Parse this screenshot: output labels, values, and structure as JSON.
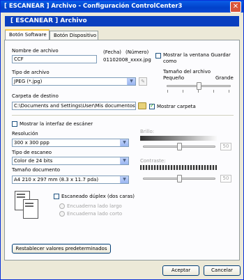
{
  "window": {
    "title": "[ ESCANEAR ]   Archivo - Configuración ControlCenter3",
    "close_symbol": "✕"
  },
  "header": {
    "title": "[ ESCANEAR ]   Archivo"
  },
  "tabs": [
    {
      "label": "Botón Software",
      "active": true
    },
    {
      "label": "Botón Dispositivo",
      "active": false
    }
  ],
  "file": {
    "name_label": "Nombre de archivo",
    "name_value": "CCF",
    "date_label": "(Fecha)",
    "number_label": "(Número)",
    "example": "01102008_xxxx.jpg",
    "show_save_as_label": "Mostrar la ventana Guardar como",
    "show_save_as_checked": false
  },
  "filetype": {
    "label": "Tipo de archivo",
    "value": "JPEG (*.jpg)"
  },
  "filesize": {
    "label": "Tamaño del archivo",
    "small": "Pequeño",
    "large": "Grande",
    "level": 0.5
  },
  "destination": {
    "label": "Carpeta de destino",
    "value": "C:\\Documents and Settings\\User\\Mis documentos\\Mi",
    "show_folder_label": "Mostrar carpeta",
    "show_folder_checked": true
  },
  "scanner_ui": {
    "label": "Mostrar la interfaz de escáner",
    "checked": false
  },
  "resolution": {
    "label": "Resolución",
    "value": "300 x 300 ppp"
  },
  "scan_type": {
    "label": "Tipo de escaneo",
    "value": "Color de 24 bits"
  },
  "doc_size": {
    "label": "Tamaño documento",
    "value": "A4 210 x 297 mm (8.3 x 11.7 pda)"
  },
  "brightness": {
    "label": "Brillo:",
    "value": "50",
    "level": 0.5
  },
  "contrast": {
    "label": "Contraste:",
    "value": "50",
    "level": 0.5
  },
  "duplex": {
    "label": "Escaneado dúplex (dos caras)",
    "checked": false,
    "options": [
      "Encuaderna lado largo",
      "Encuaderna lado corto"
    ]
  },
  "buttons": {
    "reset": "Restablecer valores predeterminados",
    "ok": "Aceptar",
    "cancel": "Cancelar"
  },
  "colors": {
    "titlebar": "#0141c9",
    "header": "#0a3fbf",
    "dialog": "#ece9d8"
  }
}
